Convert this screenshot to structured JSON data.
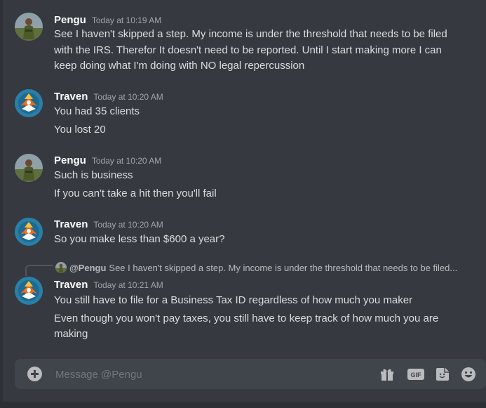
{
  "messages": [
    {
      "author": "Pengu",
      "avatar": "pengu-avatar",
      "timestamp": "Today at 10:19 AM",
      "lines": [
        "See I haven't skipped a step. My income is under the threshold that needs to be filed",
        "with the IRS. Therefor It doesn't need to be reported. Until I start making more I can",
        "keep doing what I'm doing with NO legal repercussion"
      ]
    },
    {
      "author": "Traven",
      "avatar": "traven-avatar",
      "timestamp": "Today at 10:20 AM",
      "lines": [
        "You had 35 clients",
        "You lost 20"
      ]
    },
    {
      "author": "Pengu",
      "avatar": "pengu-avatar",
      "timestamp": "Today at 10:20 AM",
      "lines": [
        "Such is business",
        "If you can't take a hit then you'll fail"
      ]
    },
    {
      "author": "Traven",
      "avatar": "traven-avatar",
      "timestamp": "Today at 10:20 AM",
      "lines": [
        "So you make less than $600 a year?"
      ]
    },
    {
      "author": "Traven",
      "avatar": "traven-avatar",
      "timestamp": "Today at 10:21 AM",
      "reply": {
        "author": "@Pengu",
        "text": "See I haven't skipped a step. My income is under the threshold that needs to be filed..."
      },
      "lines": [
        "You still have to file for a Business Tax ID regardless of how much you maker",
        "Even though you won't pay taxes, you still have to keep track of how much you are",
        "making"
      ]
    }
  ],
  "composer": {
    "placeholder": "Message @Pengu",
    "tools": [
      "gift-icon",
      "gif-icon",
      "sticker-icon",
      "emoji-icon"
    ],
    "gif_label": "GIF"
  },
  "colors": {
    "background": "#36393f",
    "input": "#40444b",
    "username": "#ffffff",
    "text": "#dcddde",
    "timestamp": "#a3a6aa",
    "traven_avatar": "#2a7fa8",
    "pengu_avatar": "#6f7b5e"
  }
}
